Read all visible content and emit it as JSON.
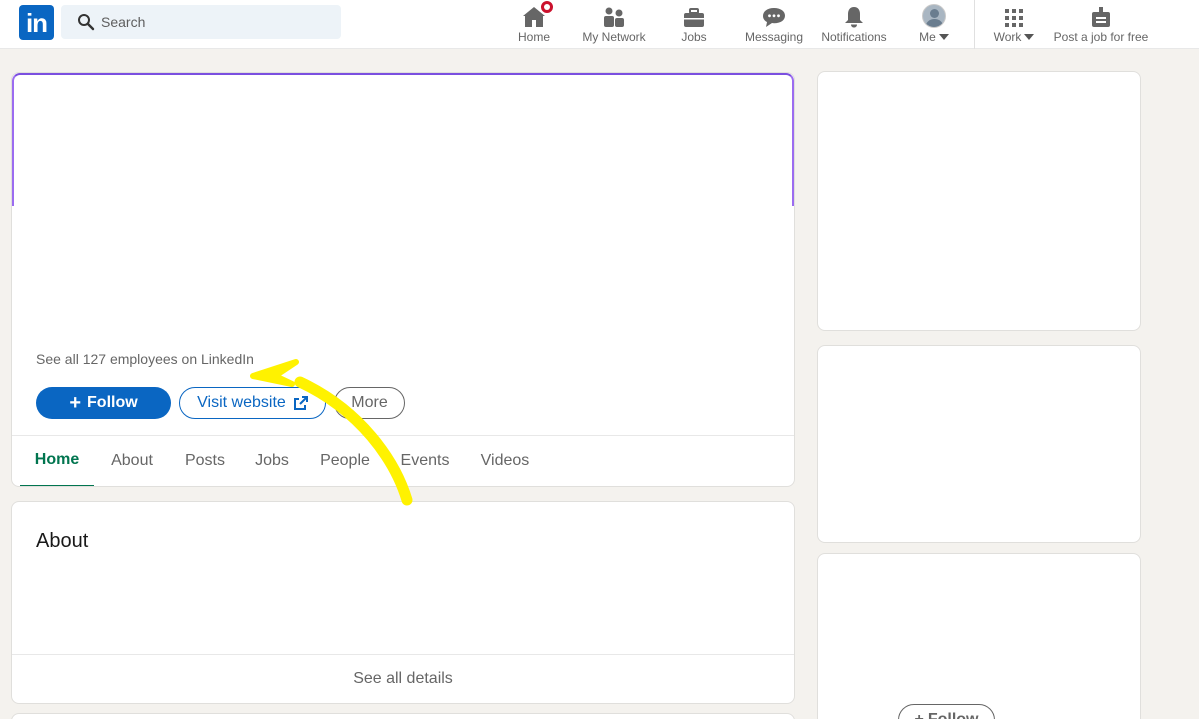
{
  "nav": {
    "search_placeholder": "Search",
    "items": [
      {
        "label": "Home",
        "icon": "home-icon"
      },
      {
        "label": "My Network",
        "icon": "my-network-icon"
      },
      {
        "label": "Jobs",
        "icon": "jobs-icon"
      },
      {
        "label": "Messaging",
        "icon": "messaging-icon"
      },
      {
        "label": "Notifications",
        "icon": "notifications-icon"
      },
      {
        "label": "Me",
        "icon": "avatar"
      },
      {
        "label": "Work",
        "icon": "grid-icon"
      },
      {
        "label": "Post a job for free",
        "icon": "post-job-icon"
      }
    ],
    "logo_text": "in"
  },
  "company": {
    "employees_link": "See all 127 employees on LinkedIn",
    "follow_label": "Follow",
    "visit_label": "Visit website",
    "more_label": "More",
    "tabs": [
      {
        "label": "Home"
      },
      {
        "label": "About"
      },
      {
        "label": "Posts"
      },
      {
        "label": "Jobs"
      },
      {
        "label": "People"
      },
      {
        "label": "Events"
      },
      {
        "label": "Videos"
      }
    ]
  },
  "about": {
    "title": "About",
    "see_all": "See all details"
  },
  "sidebar": {
    "follow_label": "Follow"
  },
  "colors": {
    "brand": "#0a66c2",
    "active_tab": "#01754f",
    "notification_badge": "#cb112d",
    "annotation_arrow": "#fff200"
  }
}
